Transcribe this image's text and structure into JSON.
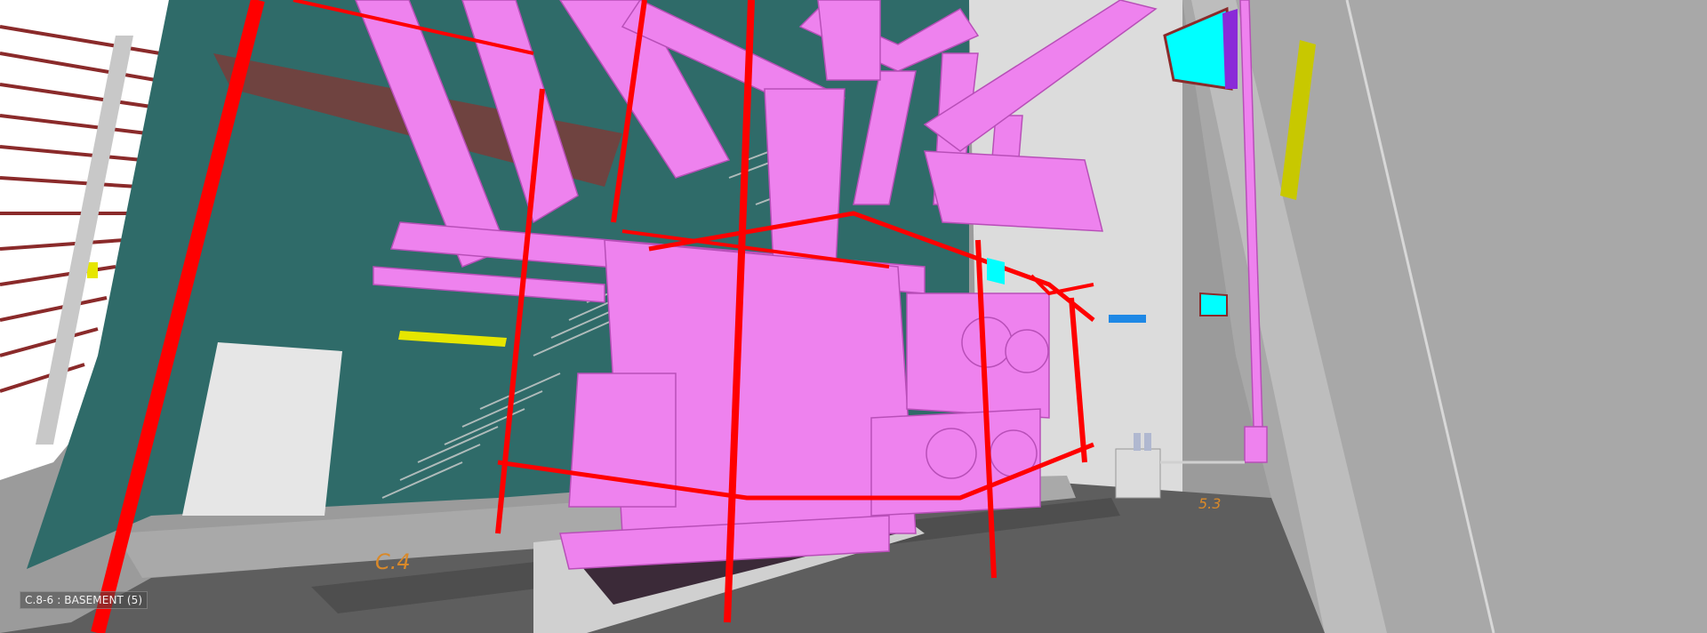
{
  "viewport": {
    "view_tag": "C.8-6 : BASEMENT (5)",
    "grid_labels": {
      "left_floor": "C.4",
      "right_floor": "5.3"
    }
  },
  "colors": {
    "equipment": "#ee82ee",
    "pipe": "#ff0000",
    "wall_teal": "#2f6b69",
    "floor": "#5e5e5e",
    "duct_cyan": "#00ffff",
    "beam_yellow": "#c8c800"
  }
}
